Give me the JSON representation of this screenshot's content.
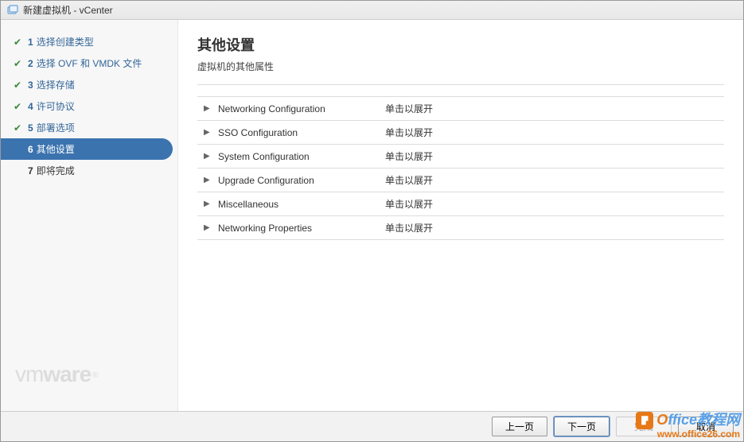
{
  "window": {
    "title": "新建虚拟机 - vCenter"
  },
  "sidebar": {
    "steps": [
      {
        "num": "1",
        "label": "选择创建类型",
        "done": true
      },
      {
        "num": "2",
        "label": "选择 OVF 和 VMDK 文件",
        "done": true
      },
      {
        "num": "3",
        "label": "选择存储",
        "done": true
      },
      {
        "num": "4",
        "label": "许可协议",
        "done": true
      },
      {
        "num": "5",
        "label": "部署选项",
        "done": true
      },
      {
        "num": "6",
        "label": "其他设置",
        "active": true
      },
      {
        "num": "7",
        "label": "即将完成",
        "pending": true
      }
    ],
    "brand": "vmware"
  },
  "content": {
    "heading": "其他设置",
    "subtitle": "虚拟机的其他属性",
    "hint": "单击以展开",
    "sections": [
      {
        "label": "Networking Configuration"
      },
      {
        "label": "SSO Configuration"
      },
      {
        "label": "System Configuration"
      },
      {
        "label": "Upgrade Configuration"
      },
      {
        "label": "Miscellaneous"
      },
      {
        "label": "Networking Properties"
      }
    ]
  },
  "footer": {
    "prev": "上一页",
    "next": "下一页",
    "finish": "完成",
    "cancel": "取消"
  },
  "watermark": {
    "line1_a": "O",
    "line1_b": "ffice教程网",
    "line2": "www.office26.com"
  }
}
